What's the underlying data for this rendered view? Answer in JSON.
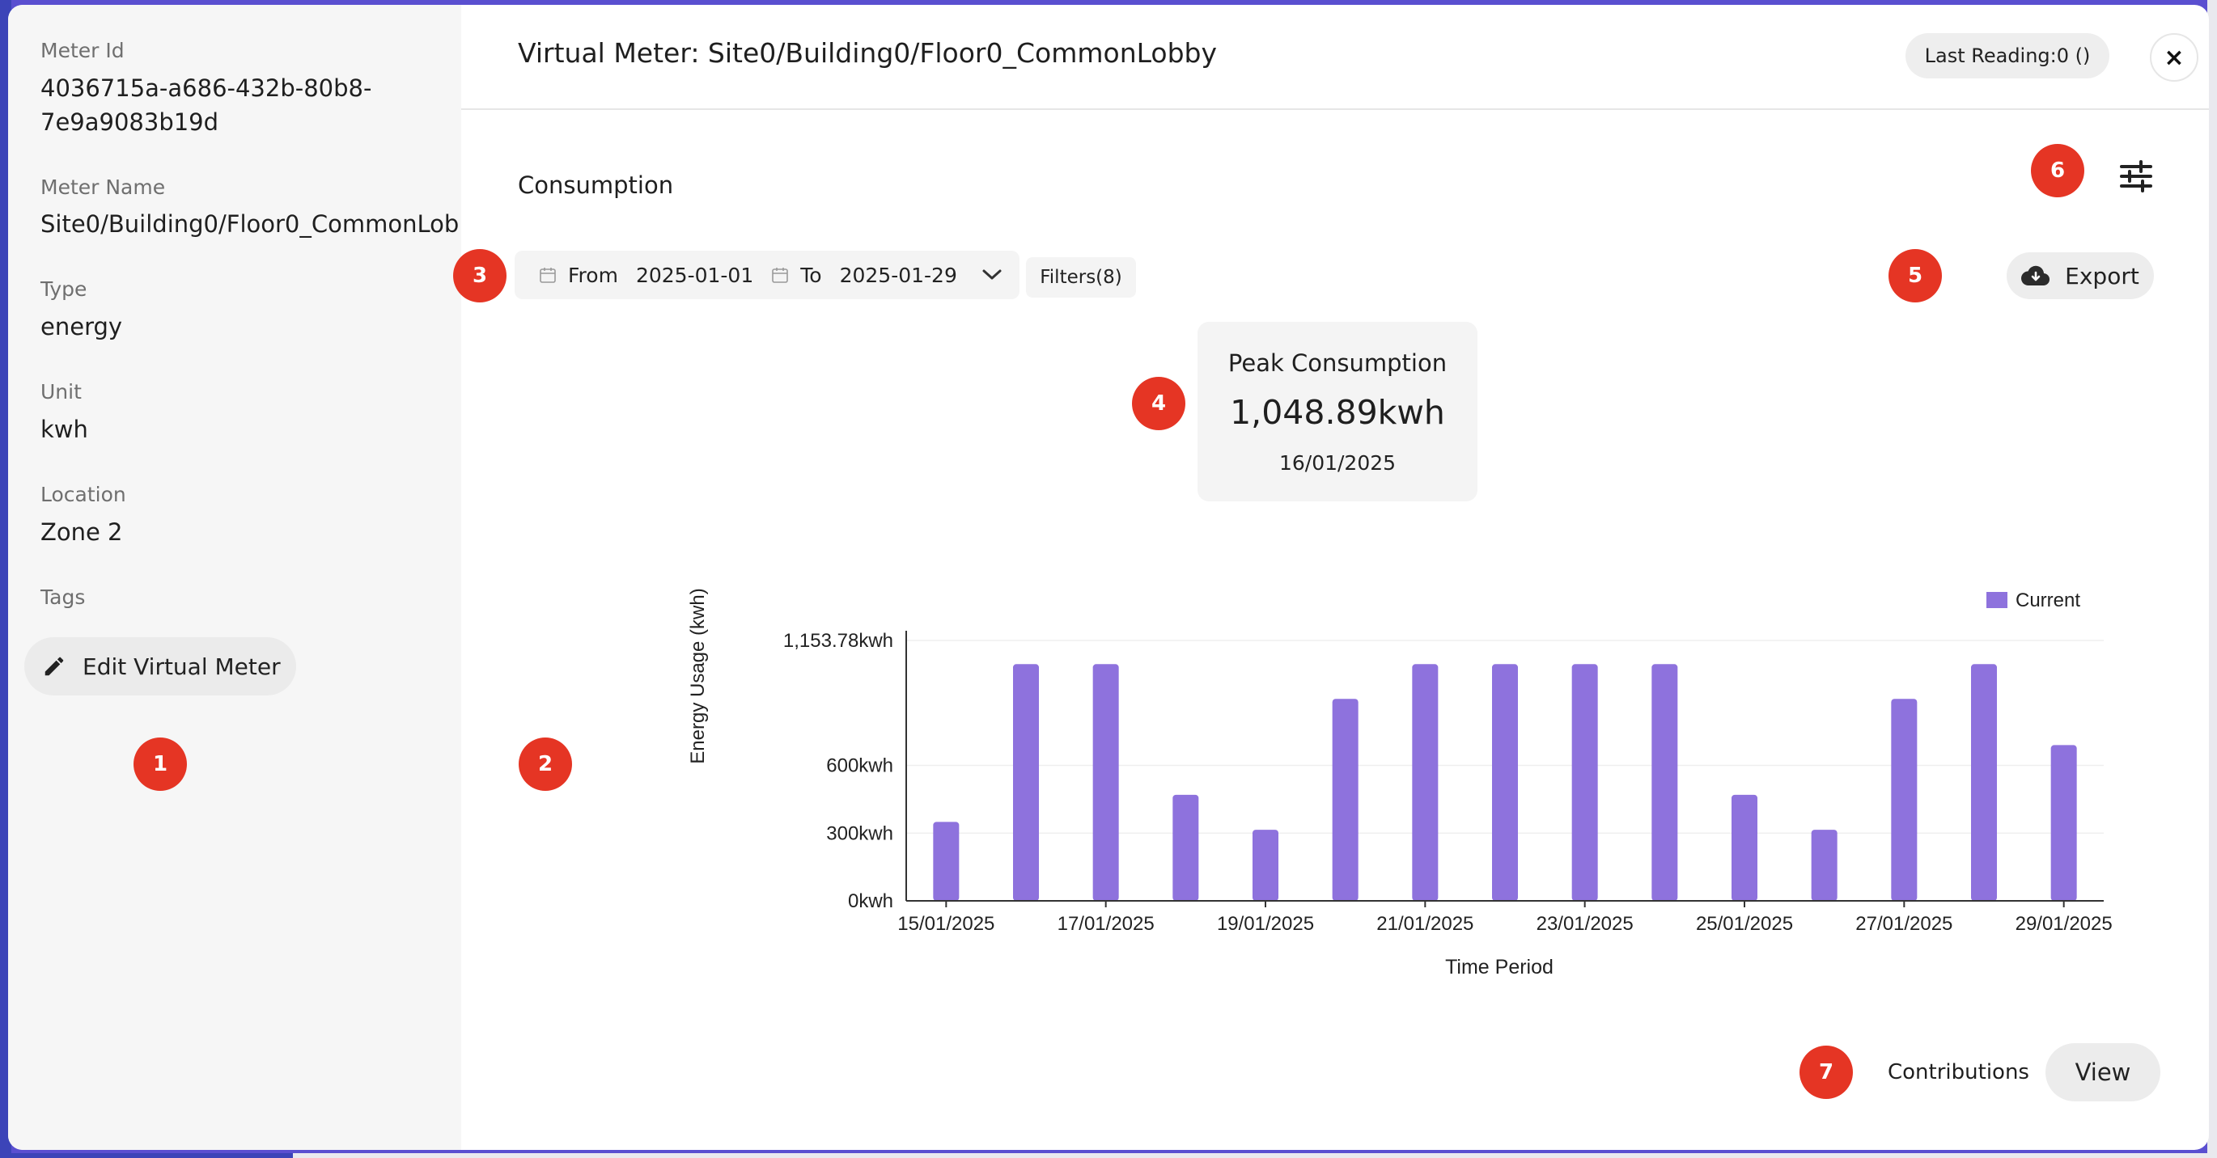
{
  "meter_details": {
    "meter_id_label": "Meter Id",
    "meter_id_line1": "4036715a-a686-432b-80b8-",
    "meter_id_line2": "7e9a9083b19d",
    "meter_name_label": "Meter Name",
    "meter_name_value": "Site0/Building0/Floor0_CommonLob",
    "type_label": "Type",
    "type_value": "energy",
    "unit_label": "Unit",
    "unit_value": "kwh",
    "location_label": "Location",
    "location_value": "Zone 2",
    "tags_label": "Tags",
    "edit_button_label": "Edit Virtual Meter",
    "edit_icon": "pencil-icon"
  },
  "header": {
    "title": "Virtual Meter: Site0/Building0/Floor0_CommonLobby",
    "last_reading": "Last Reading:0 ()",
    "close_label": "×"
  },
  "consumption": {
    "section_title": "Consumption",
    "settings_icon": "sliders-icon",
    "from_label": "From",
    "from_value": "2025-01-01",
    "to_label": "To",
    "to_value": "2025-01-29",
    "filters_label": "Filters(8)",
    "export_label": "Export",
    "export_icon": "cloud-download-icon",
    "peak_title": "Peak Consumption",
    "peak_value": "1,048.89kwh",
    "peak_date": "16/01/2025"
  },
  "markers": [
    "1",
    "2",
    "3",
    "4",
    "5",
    "6",
    "7"
  ],
  "contributions": {
    "label": "Contributions",
    "view_label": "View"
  },
  "colors": {
    "bar": "#8e72dd",
    "marker": "#e53524",
    "panel": "#f6f6f6"
  },
  "chart_data": {
    "type": "bar",
    "title": "",
    "xlabel": "Time Period",
    "ylabel": "Energy Usage (kwh)",
    "legend": "top-right",
    "grid": true,
    "ylim": [
      0,
      1153.78
    ],
    "yticks": [
      "0kwh",
      "300kwh",
      "600kwh",
      "1,153.78kwh"
    ],
    "ytick_values": [
      0,
      300,
      600,
      1153.78
    ],
    "categories": [
      "15/01/2025",
      "16/01/2025",
      "17/01/2025",
      "18/01/2025",
      "19/01/2025",
      "20/01/2025",
      "21/01/2025",
      "22/01/2025",
      "23/01/2025",
      "24/01/2025",
      "25/01/2025",
      "26/01/2025",
      "27/01/2025",
      "28/01/2025",
      "29/01/2025"
    ],
    "xtick_labels": [
      "15/01/2025",
      "17/01/2025",
      "19/01/2025",
      "21/01/2025",
      "23/01/2025",
      "25/01/2025",
      "27/01/2025",
      "29/01/2025"
    ],
    "series": [
      {
        "name": "Current",
        "values": [
          350,
          1048.89,
          1048.89,
          470,
          315,
          895,
          1048.89,
          1048.89,
          1048.89,
          1048.89,
          470,
          315,
          895,
          1048.89,
          690
        ]
      }
    ]
  }
}
